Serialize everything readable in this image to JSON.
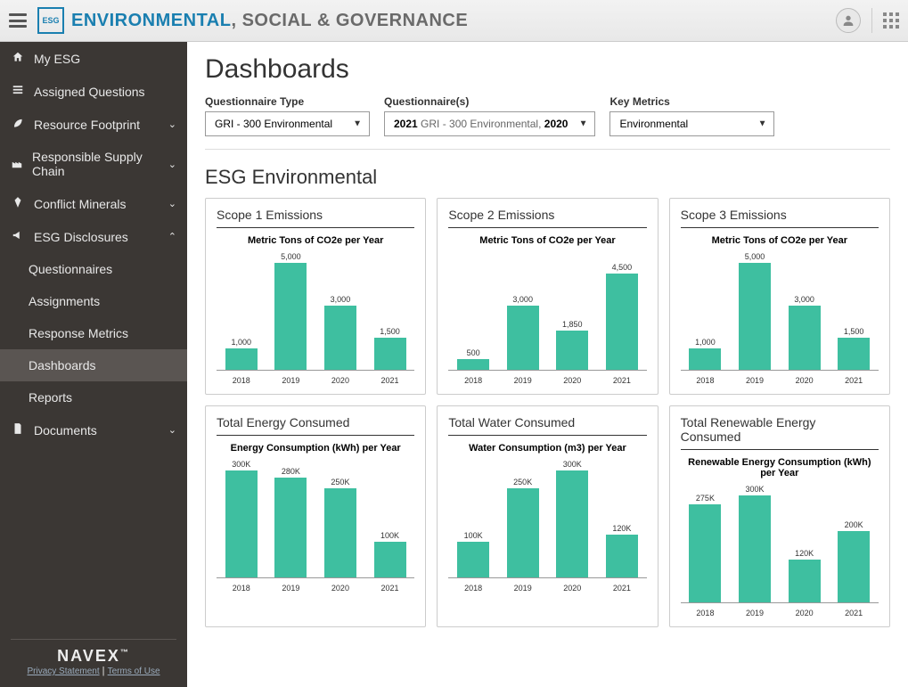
{
  "brand": {
    "env": "ENVIRONMENTAL",
    "rest": ", SOCIAL & GOVERNANCE",
    "logo": "ESG"
  },
  "sidebar": {
    "items": [
      {
        "label": "My ESG",
        "name": "sidebar-item-my-esg",
        "icon": "home",
        "expand": null
      },
      {
        "label": "Assigned Questions",
        "name": "sidebar-item-assigned-questions",
        "icon": "list",
        "expand": null
      },
      {
        "label": "Resource Footprint",
        "name": "sidebar-item-resource-footprint",
        "icon": "leaf",
        "expand": "down"
      },
      {
        "label": "Responsible Supply Chain",
        "name": "sidebar-item-supply-chain",
        "icon": "factory",
        "expand": "down"
      },
      {
        "label": "Conflict Minerals",
        "name": "sidebar-item-conflict-minerals",
        "icon": "diamond",
        "expand": "down"
      },
      {
        "label": "ESG Disclosures",
        "name": "sidebar-item-esg-disclosures",
        "icon": "horn",
        "expand": "up"
      }
    ],
    "subitems": [
      {
        "label": "Questionnaires",
        "name": "sidebar-sub-questionnaires"
      },
      {
        "label": "Assignments",
        "name": "sidebar-sub-assignments"
      },
      {
        "label": "Response Metrics",
        "name": "sidebar-sub-response-metrics"
      },
      {
        "label": "Dashboards",
        "name": "sidebar-sub-dashboards",
        "active": true
      },
      {
        "label": "Reports",
        "name": "sidebar-sub-reports"
      }
    ],
    "documents": {
      "label": "Documents",
      "name": "sidebar-item-documents",
      "icon": "doc",
      "expand": "down"
    },
    "footer": {
      "brand": "NAVEX",
      "tm": "™",
      "privacy": "Privacy Statement",
      "sep": " | ",
      "terms": "Terms of Use"
    }
  },
  "main": {
    "title": "Dashboards",
    "filters": {
      "type": {
        "label": "Questionnaire Type",
        "value": "GRI - 300 Environmental"
      },
      "questionnaires": {
        "label": "Questionnaire(s)",
        "y1": "2021",
        "mid": " GRI - 300 Environmental, ",
        "y2": "2020"
      },
      "metrics": {
        "label": "Key Metrics",
        "value": "Environmental"
      }
    },
    "section": "ESG Environmental"
  },
  "chart_data": [
    {
      "type": "bar",
      "title": "Scope 1 Emissions",
      "chart_title": "Metric Tons of CO2e per Year",
      "categories": [
        "2018",
        "2019",
        "2020",
        "2021"
      ],
      "values": [
        1000,
        5000,
        3000,
        1500
      ],
      "labels": [
        "1,000",
        "5,000",
        "3,000",
        "1,500"
      ],
      "max": 5000
    },
    {
      "type": "bar",
      "title": "Scope 2 Emissions",
      "chart_title": "Metric Tons of CO2e per Year",
      "categories": [
        "2018",
        "2019",
        "2020",
        "2021"
      ],
      "values": [
        500,
        3000,
        1850,
        4500
      ],
      "labels": [
        "500",
        "3,000",
        "1,850",
        "4,500"
      ],
      "max": 5000
    },
    {
      "type": "bar",
      "title": "Scope 3 Emissions",
      "chart_title": "Metric Tons of CO2e per Year",
      "categories": [
        "2018",
        "2019",
        "2020",
        "2021"
      ],
      "values": [
        1000,
        5000,
        3000,
        1500
      ],
      "labels": [
        "1,000",
        "5,000",
        "3,000",
        "1,500"
      ],
      "max": 5000
    },
    {
      "type": "bar",
      "title": "Total Energy Consumed",
      "chart_title": "Energy Consumption (kWh) per Year",
      "categories": [
        "2018",
        "2019",
        "2020",
        "2021"
      ],
      "values": [
        300000,
        280000,
        250000,
        100000
      ],
      "labels": [
        "300K",
        "280K",
        "250K",
        "100K"
      ],
      "max": 300000
    },
    {
      "type": "bar",
      "title": "Total Water Consumed",
      "chart_title": "Water Consumption (m3) per Year",
      "categories": [
        "2018",
        "2019",
        "2020",
        "2021"
      ],
      "values": [
        100000,
        250000,
        300000,
        120000
      ],
      "labels": [
        "100K",
        "250K",
        "300K",
        "120K"
      ],
      "max": 300000
    },
    {
      "type": "bar",
      "title": "Total Renewable Energy Consumed",
      "chart_title": "Renewable Energy Consumption (kWh) per Year",
      "categories": [
        "2018",
        "2019",
        "2020",
        "2021"
      ],
      "values": [
        275000,
        300000,
        120000,
        200000
      ],
      "labels": [
        "275K",
        "300K",
        "120K",
        "200K"
      ],
      "max": 300000
    }
  ]
}
